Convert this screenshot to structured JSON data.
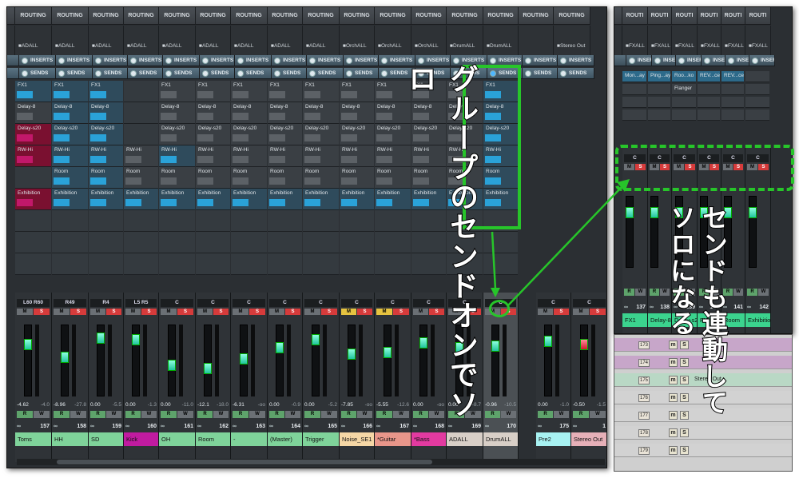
{
  "routing_header": "ROUTING",
  "inserts_label": "INSERTS",
  "sends_label": "SENDS",
  "channels": [
    {
      "routing": "ADALL",
      "pan": "L60  R60",
      "solo": false,
      "mute": false,
      "vol": "-4.62",
      "peak": "-4.0",
      "num": "157",
      "name": "Toms",
      "color": "#7fd39a"
    },
    {
      "routing": "ADALL",
      "pan": "R49",
      "solo": false,
      "mute": false,
      "vol": "-8.96",
      "peak": "-27.8",
      "num": "158",
      "name": "HH",
      "color": "#7fd39a"
    },
    {
      "routing": "ADALL",
      "pan": "R4",
      "solo": false,
      "mute": false,
      "vol": "0.00",
      "peak": "-5.5",
      "num": "159",
      "name": "SD",
      "color": "#7fd39a"
    },
    {
      "routing": "ADALL",
      "pan": "L5  R5",
      "solo": false,
      "mute": false,
      "vol": "0.00",
      "peak": "-1.3",
      "num": "160",
      "name": "Kick",
      "color": "#c01ba0"
    },
    {
      "routing": "ADALL",
      "pan": "C",
      "solo": false,
      "mute": false,
      "vol": "0.00",
      "peak": "-11.0",
      "num": "161",
      "name": "OH",
      "color": "#7fd39a"
    },
    {
      "routing": "ADALL",
      "pan": "C",
      "solo": false,
      "mute": false,
      "vol": "-12.1",
      "peak": "-18.0",
      "num": "162",
      "name": "Room",
      "color": "#7fd39a"
    },
    {
      "routing": "ADALL",
      "pan": "C",
      "solo": false,
      "mute": false,
      "vol": "-6.31",
      "peak": "-oo",
      "num": "163",
      "name": "-",
      "color": "#7fd39a"
    },
    {
      "routing": "ADALL",
      "pan": "C",
      "solo": false,
      "mute": false,
      "vol": "0.00",
      "peak": "-0.9",
      "num": "164",
      "name": "(Master)",
      "color": "#7fd39a"
    },
    {
      "routing": "ADALL",
      "pan": "C",
      "solo": false,
      "mute": false,
      "vol": "0.00",
      "peak": "-5.2",
      "num": "165",
      "name": "Trigger",
      "color": "#7fd39a"
    },
    {
      "routing": "OrchALL",
      "pan": "C",
      "solo": false,
      "mute": true,
      "vol": "-7.85",
      "peak": "-oo",
      "num": "166",
      "name": "Noise_SE1",
      "color": "#f5d7a6"
    },
    {
      "routing": "OrchALL",
      "pan": "C",
      "solo": false,
      "mute": true,
      "vol": "-5.55",
      "peak": "-12.6",
      "num": "167",
      "name": "*Guitar",
      "color": "#e8968a"
    },
    {
      "routing": "OrchALL",
      "pan": "C",
      "solo": false,
      "mute": false,
      "vol": "0.00",
      "peak": "-oo",
      "num": "168",
      "name": "*Bass",
      "color": "#e23aa0"
    },
    {
      "routing": "DrumALL",
      "pan": "C",
      "solo": false,
      "mute": false,
      "vol": "0.00",
      "peak": "-8.7",
      "num": "169",
      "name": "ADALL",
      "color": "#d8cfc7"
    },
    {
      "routing": "DrumALL",
      "pan": "C",
      "solo": true,
      "mute": false,
      "vol": "-0.96",
      "peak": "-10.5",
      "num": "170",
      "name": "DrumALL",
      "color": "#d8cfc7"
    },
    {
      "routing": "",
      "pan": "C",
      "solo": false,
      "mute": false,
      "vol": "0.00",
      "peak": "-1.0",
      "num": "175",
      "name": "Pre2",
      "color": "#a8f2f2"
    },
    {
      "routing": "Stereo Out",
      "pan": "C",
      "solo": false,
      "mute": false,
      "vol": "-0.50",
      "peak": "-1.5",
      "num": "1",
      "name": "Stereo Out",
      "color": "#e6b0b8"
    }
  ],
  "side_channels": [
    {
      "routing": "FXALL",
      "insert": "Mon...ay",
      "num": "137",
      "name": "FX1",
      "color": "#3bd38e"
    },
    {
      "routing": "FXALL",
      "insert": "Ping...ay",
      "num": "138",
      "name": "Delay-8",
      "color": "#3bd38e"
    },
    {
      "routing": "FXALL",
      "insert": "Roo...ko",
      "num": "139",
      "name": "Delay-s20",
      "color": "#3bd38e"
    },
    {
      "routing": "FXALL",
      "insert": "REV...ce",
      "num": "140",
      "name": "RW-Hi",
      "color": "#3bd38e"
    },
    {
      "routing": "FXALL",
      "insert": "REV...ce",
      "num": "141",
      "name": "Room",
      "color": "#3bd38e"
    },
    {
      "routing": "FXALL",
      "insert": "",
      "num": "142",
      "name": "Exhibitio",
      "color": "#3bd38e"
    }
  ],
  "side_header": "ROUTI",
  "side_insert_extra": "Flanger",
  "annotation_left": "グループのセンドオンでソロ",
  "annotation_right_1": "センドも連動して",
  "annotation_right_2": "ソロになる",
  "tracklist": [
    "173",
    "174",
    "175",
    "176",
    "177",
    "178",
    "179"
  ],
  "tracklist_label": "Stereo Out"
}
